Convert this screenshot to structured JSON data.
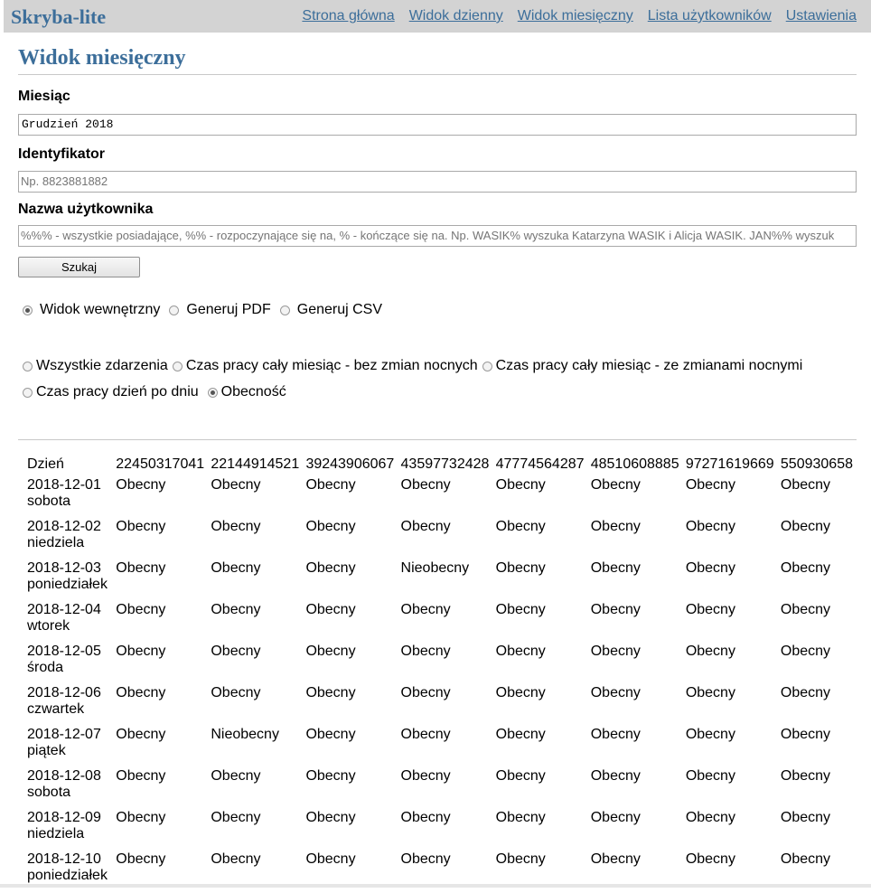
{
  "app": {
    "brand": "Skryba-lite",
    "nav": [
      "Strona główna",
      "Widok dzienny",
      "Widok miesięczny",
      "Lista użytkowników",
      "Ustawienia"
    ]
  },
  "page": {
    "title": "Widok miesięczny"
  },
  "form": {
    "month_label": "Miesiąc",
    "month_value": "Grudzień 2018",
    "id_label": "Identyfikator",
    "id_placeholder": "Np. 8823881882",
    "name_label": "Nazwa użytkownika",
    "name_placeholder": "%%% - wszystkie posiadające, %% - rozpoczynające się na, % - kończące się na. Np. WASIK% wyszuka Katarzyna WASIK i Alicja WASIK. JAN%% wyszuk",
    "search_button": "Szukaj"
  },
  "output_options": [
    {
      "label": "Widok wewnętrzny",
      "checked": true
    },
    {
      "label": "Generuj PDF",
      "checked": false
    },
    {
      "label": "Generuj CSV",
      "checked": false
    }
  ],
  "report_options": [
    {
      "label": "Wszystkie zdarzenia",
      "checked": false
    },
    {
      "label": "Czas pracy cały miesiąc - bez zmian nocnych",
      "checked": false
    },
    {
      "label": "Czas pracy cały miesiąc - ze zmianami nocnymi",
      "checked": false
    },
    {
      "label": "Czas pracy dzień po dniu",
      "checked": false
    },
    {
      "label": "Obecność",
      "checked": true
    }
  ],
  "table": {
    "headers": [
      "Dzień",
      "22450317041",
      "22144914521",
      "39243906067",
      "43597732428",
      "47774564287",
      "48510608885",
      "97271619669",
      "550930658"
    ],
    "rows": [
      {
        "date": "2018-12-01",
        "weekday": "sobota",
        "values": [
          "Obecny",
          "Obecny",
          "Obecny",
          "Obecny",
          "Obecny",
          "Obecny",
          "Obecny",
          "Obecny"
        ]
      },
      {
        "date": "2018-12-02",
        "weekday": "niedziela",
        "values": [
          "Obecny",
          "Obecny",
          "Obecny",
          "Obecny",
          "Obecny",
          "Obecny",
          "Obecny",
          "Obecny"
        ]
      },
      {
        "date": "2018-12-03",
        "weekday": "poniedziałek",
        "values": [
          "Obecny",
          "Obecny",
          "Obecny",
          "Nieobecny",
          "Obecny",
          "Obecny",
          "Obecny",
          "Obecny"
        ]
      },
      {
        "date": "2018-12-04",
        "weekday": "wtorek",
        "values": [
          "Obecny",
          "Obecny",
          "Obecny",
          "Obecny",
          "Obecny",
          "Obecny",
          "Obecny",
          "Obecny"
        ]
      },
      {
        "date": "2018-12-05",
        "weekday": "środa",
        "values": [
          "Obecny",
          "Obecny",
          "Obecny",
          "Obecny",
          "Obecny",
          "Obecny",
          "Obecny",
          "Obecny"
        ]
      },
      {
        "date": "2018-12-06",
        "weekday": "czwartek",
        "values": [
          "Obecny",
          "Obecny",
          "Obecny",
          "Obecny",
          "Obecny",
          "Obecny",
          "Obecny",
          "Obecny"
        ]
      },
      {
        "date": "2018-12-07",
        "weekday": "piątek",
        "values": [
          "Obecny",
          "Nieobecny",
          "Obecny",
          "Obecny",
          "Obecny",
          "Obecny",
          "Obecny",
          "Obecny"
        ]
      },
      {
        "date": "2018-12-08",
        "weekday": "sobota",
        "values": [
          "Obecny",
          "Obecny",
          "Obecny",
          "Obecny",
          "Obecny",
          "Obecny",
          "Obecny",
          "Obecny"
        ]
      },
      {
        "date": "2018-12-09",
        "weekday": "niedziela",
        "values": [
          "Obecny",
          "Obecny",
          "Obecny",
          "Obecny",
          "Obecny",
          "Obecny",
          "Obecny",
          "Obecny"
        ]
      },
      {
        "date": "2018-12-10",
        "weekday": "poniedziałek",
        "values": [
          "Obecny",
          "Obecny",
          "Obecny",
          "Obecny",
          "Obecny",
          "Obecny",
          "Obecny",
          "Obecny"
        ]
      }
    ]
  }
}
